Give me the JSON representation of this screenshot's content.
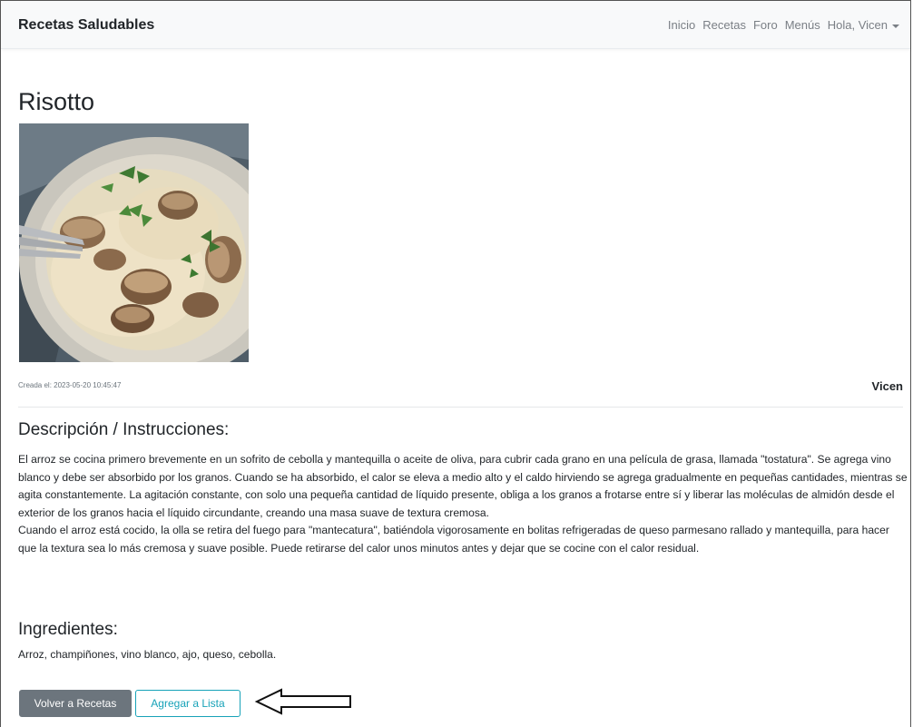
{
  "navbar": {
    "brand": "Recetas Saludables",
    "links": [
      "Inicio",
      "Recetas",
      "Foro",
      "Menús"
    ],
    "user_menu": "Hola, Vicen"
  },
  "recipe": {
    "title": "Risotto",
    "created": "Creada el: 2023-05-20 10:45:47",
    "author": "Vicen",
    "description_heading": "Descripción / Instrucciones:",
    "description": [
      "El arroz se cocina primero brevemente en un sofrito de cebolla y mantequilla o aceite de oliva, para cubrir cada grano en una película de grasa, llamada \"tostatura\". Se agrega vino blanco y debe ser absorbido por los granos. Cuando se ha absorbido, el calor se eleva a medio alto y el caldo hirviendo se agrega gradualmente en pequeñas cantidades, mientras se agita constantemente. La agitación constante, con solo una pequeña cantidad de líquido presente, obliga a los granos a frotarse entre sí y liberar las moléculas de almidón desde el exterior de los granos hacia el líquido circundante, creando una masa suave de textura cremosa.",
      "Cuando el arroz está cocido, la olla se retira del fuego para \"mantecatura\", batiéndola vigorosamente en bolitas refrigeradas de queso parmesano rallado y mantequilla, para hacer que la textura sea lo más cremosa y suave posible. Puede retirarse del calor unos minutos antes y dejar que se cocine con el calor residual."
    ],
    "ingredients_heading": "Ingredientes:",
    "ingredients": "Arroz, champiñones, vino blanco, ajo, queso, cebolla."
  },
  "actions": {
    "back_label": "Volver a Recetas",
    "add_label": "Agregar a Lista"
  },
  "colors": {
    "navbar_bg": "#f8f9fa",
    "btn_secondary": "#6c757d",
    "btn_info_outline": "#17a2b8"
  }
}
